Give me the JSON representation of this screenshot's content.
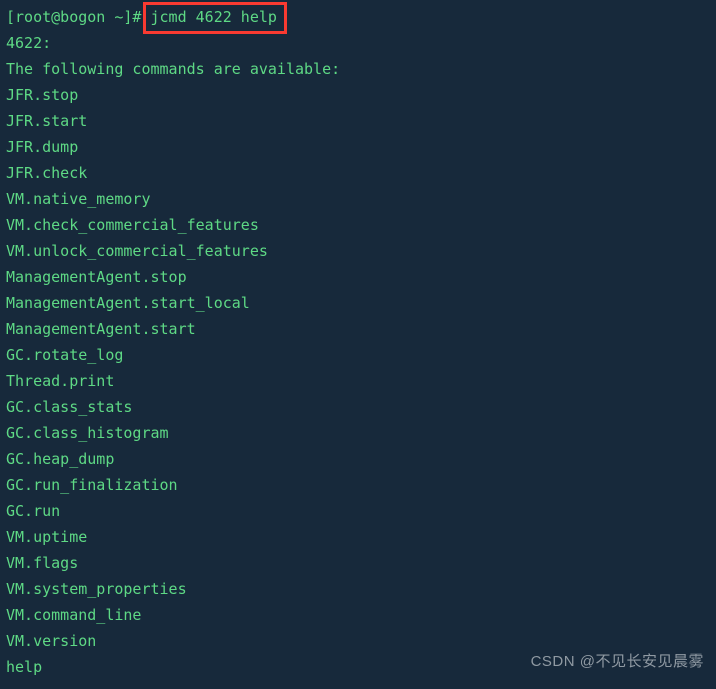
{
  "terminal": {
    "background_color": "#17293b",
    "text_color": "#5ed985",
    "highlight_color": "#f93a31",
    "prompt": "[root@bogon ~]#",
    "command": "jcmd 4622 help",
    "lines": [
      "4622:",
      "The following commands are available:",
      "JFR.stop",
      "JFR.start",
      "JFR.dump",
      "JFR.check",
      "VM.native_memory",
      "VM.check_commercial_features",
      "VM.unlock_commercial_features",
      "ManagementAgent.stop",
      "ManagementAgent.start_local",
      "ManagementAgent.start",
      "GC.rotate_log",
      "Thread.print",
      "GC.class_stats",
      "GC.class_histogram",
      "GC.heap_dump",
      "GC.run_finalization",
      "GC.run",
      "VM.uptime",
      "VM.flags",
      "VM.system_properties",
      "VM.command_line",
      "VM.version",
      "help"
    ]
  },
  "watermark": {
    "text": "CSDN @不见长安见晨雾",
    "color": "#8f99a2"
  }
}
